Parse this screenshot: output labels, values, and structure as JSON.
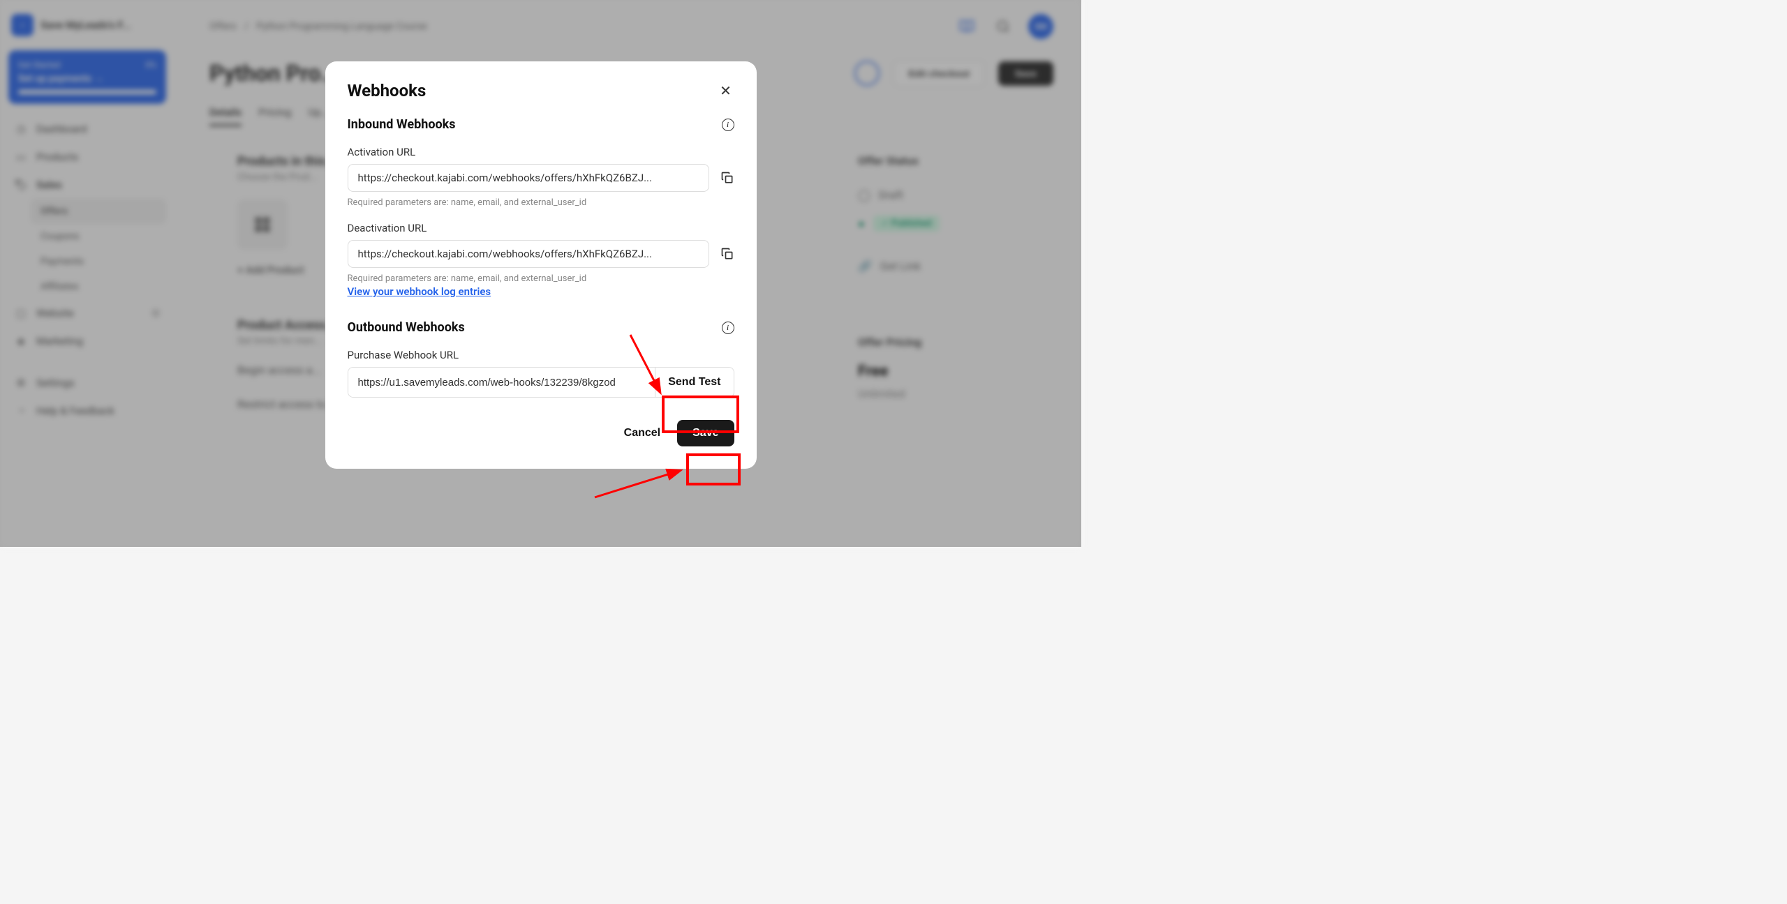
{
  "sidebar": {
    "logo_letter": "‹",
    "title": "Save MyLeads's F...",
    "promo": {
      "top_left": "Get Started",
      "top_right": "0%",
      "mid": "Set up payments  →"
    },
    "nav": {
      "dashboard": "Dashboard",
      "products": "Products",
      "sales": "Sales",
      "website": "Website",
      "marketing": "Marketing",
      "settings": "Settings",
      "help": "Help & Feedback"
    },
    "subnav": {
      "offers": "Offers",
      "coupons": "Coupons",
      "payments": "Payments",
      "affiliates": "Affiliates"
    }
  },
  "header": {
    "breadcrumb_offers": "Offers",
    "breadcrumb_sep": "/",
    "breadcrumb_page": "Python Programming Language Course",
    "avatar": "SM"
  },
  "page": {
    "title": "Python Pro...",
    "edit_checkout": "Edit checkout",
    "save": "Save",
    "tabs": {
      "details": "Details",
      "pricing": "Pricing",
      "upsell": "Up..."
    },
    "products_title": "Products in this...",
    "products_sub": "Choose the Prod...",
    "add_product": "+  Add Product",
    "access_title": "Product Access...",
    "access_sub": "Set limits for men...",
    "begin_access": "Begin access a...",
    "restrict": "Restrict access to a specific amount of days"
  },
  "side": {
    "offer_status": "Offer Status",
    "draft": "Draft",
    "published": "Published",
    "get_link": "Get Link",
    "offer_pricing": "Offer Pricing",
    "free": "Free",
    "unlimited": "Unlimited"
  },
  "modal": {
    "title": "Webhooks",
    "inbound_title": "Inbound Webhooks",
    "activation_label": "Activation URL",
    "activation_url": "https://checkout.kajabi.com/webhooks/offers/hXhFkQZ6BZJ...",
    "required_params": "Required parameters are: name, email, and external_user_id",
    "deactivation_label": "Deactivation URL",
    "deactivation_url": "https://checkout.kajabi.com/webhooks/offers/hXhFkQZ6BZJ...",
    "view_log": "View your webhook log entries",
    "outbound_title": "Outbound Webhooks",
    "purchase_label": "Purchase Webhook URL",
    "purchase_url": "https://u1.savemyleads.com/web-hooks/132239/8kgzod",
    "send_test": "Send Test",
    "cancel": "Cancel",
    "save": "Save"
  }
}
